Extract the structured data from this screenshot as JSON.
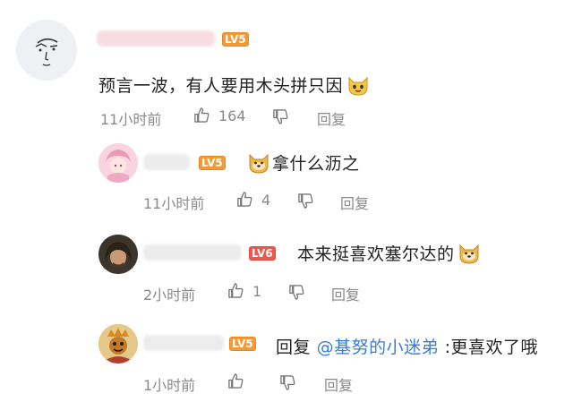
{
  "comments": [
    {
      "level": "LV5",
      "text": "预言一波，有人要用木头拼只因",
      "time": "11小时前",
      "likes": "164",
      "reply_label": "回复"
    },
    {
      "level": "LV5",
      "text": "拿什么沥之",
      "time": "11小时前",
      "likes": "4",
      "reply_label": "回复"
    },
    {
      "level": "LV6",
      "text": "本来挺喜欢塞尔达的",
      "time": "2小时前",
      "likes": "1",
      "reply_label": "回复"
    },
    {
      "level": "LV5",
      "reply_prefix": "回复",
      "mention": "@基努的小迷弟",
      "text_after": ":更喜欢了哦",
      "time": "1小时前",
      "reply_label": "回复"
    }
  ],
  "icons": {
    "like": "thumbs-up-icon",
    "dislike": "thumbs-down-icon",
    "emoji_cat": "cat-face-emoji",
    "emoji_dog": "dog-face-emoji"
  },
  "colors": {
    "lv5": "#f39a36",
    "lv6": "#f0574b",
    "mention": "#3a7bd5",
    "meta": "#8a8a8a"
  }
}
